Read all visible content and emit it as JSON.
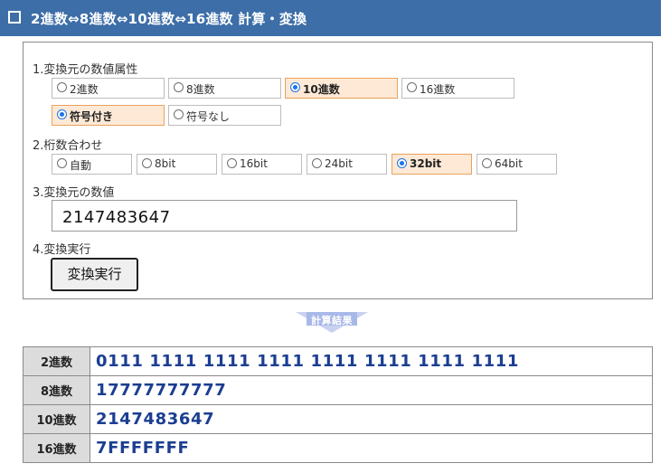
{
  "header": {
    "title": "2進数⇔8進数⇔10進数⇔16進数 計算・変換"
  },
  "section1": {
    "label": "1.変換元の数値属性",
    "base_options": [
      {
        "label": "2進数",
        "selected": false
      },
      {
        "label": "8進数",
        "selected": false
      },
      {
        "label": "10進数",
        "selected": true
      },
      {
        "label": "16進数",
        "selected": false
      }
    ],
    "sign_options": [
      {
        "label": "符号付き",
        "selected": true
      },
      {
        "label": "符号なし",
        "selected": false
      }
    ]
  },
  "section2": {
    "label": "2.桁数合わせ",
    "options": [
      {
        "label": "自動",
        "selected": false
      },
      {
        "label": "8bit",
        "selected": false
      },
      {
        "label": "16bit",
        "selected": false
      },
      {
        "label": "24bit",
        "selected": false
      },
      {
        "label": "32bit",
        "selected": true
      },
      {
        "label": "64bit",
        "selected": false
      }
    ]
  },
  "section3": {
    "label": "3.変換元の数値",
    "value": "2147483647"
  },
  "section4": {
    "label": "4.変換実行",
    "button": "変換実行"
  },
  "results": {
    "badge": "計算結果",
    "rows": [
      {
        "label": "2進数",
        "value": "0111 1111 1111 1111 1111 1111 1111 1111"
      },
      {
        "label": "8進数",
        "value": "17777777777"
      },
      {
        "label": "10進数",
        "value": "2147483647"
      },
      {
        "label": "16進数",
        "value": "7FFFFFFF"
      }
    ]
  },
  "colors": {
    "header_bg": "#3d6ea8",
    "selected_bg": "#fde9d6",
    "selected_border": "#e9a15c",
    "result_text": "#1b3e91",
    "badge": "#a8b8e8"
  }
}
